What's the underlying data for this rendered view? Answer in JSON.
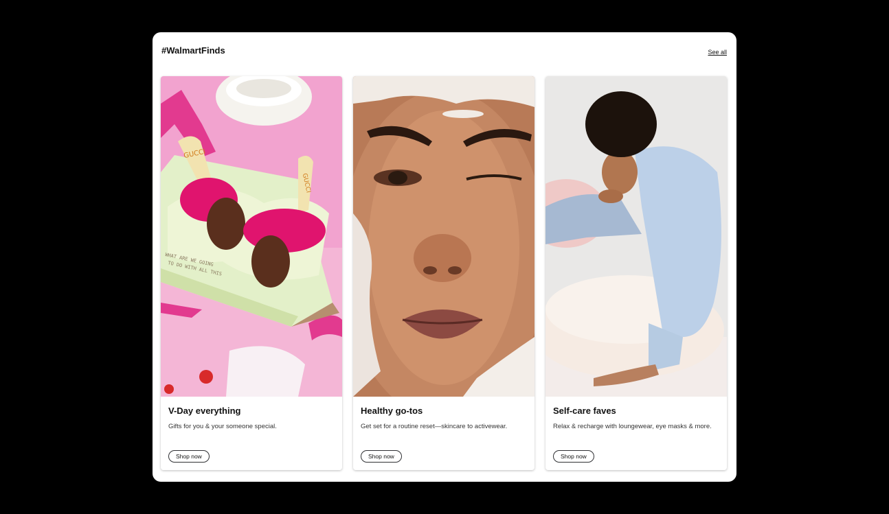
{
  "section": {
    "title": "#WalmartFinds",
    "see_all_label": "See all"
  },
  "cards": [
    {
      "title": "V-Day everything",
      "description": "Gifts for you & your someone special.",
      "cta_label": "Shop now",
      "image_text": "GUCCI",
      "image_note_line1": "WHAT ARE WE GOING",
      "image_note_line2": "TO DO WITH ALL THIS"
    },
    {
      "title": "Healthy go-tos",
      "description": "Get set for a routine reset—skincare to activewear.",
      "cta_label": "Shop now"
    },
    {
      "title": "Self-care faves",
      "description": "Relax & recharge with loungewear, eye masks & more.",
      "cta_label": "Shop now"
    }
  ],
  "colors": {
    "page_background": "#000000",
    "panel_background": "#ffffff",
    "text_primary": "#111111"
  }
}
